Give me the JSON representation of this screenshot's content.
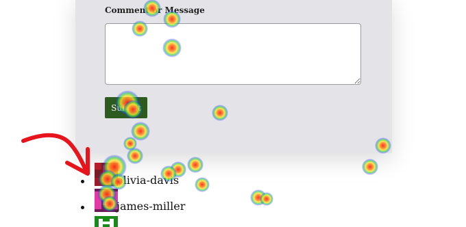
{
  "form": {
    "field_label": "Comment or Message",
    "message_value": "",
    "submit_label": "Submit"
  },
  "users": [
    {
      "username": "olivia-davis"
    },
    {
      "username": "james-miller"
    }
  ],
  "colors": {
    "card_bg": "#e4e4e8",
    "submit_bg": "#2d5a1e",
    "annotation_arrow": "#e8141b",
    "heat_core": "#ff2a1a",
    "heat_mid": "#ffe633",
    "heat_outer": "#32d24a",
    "heat_edge": "#2b3cff"
  }
}
